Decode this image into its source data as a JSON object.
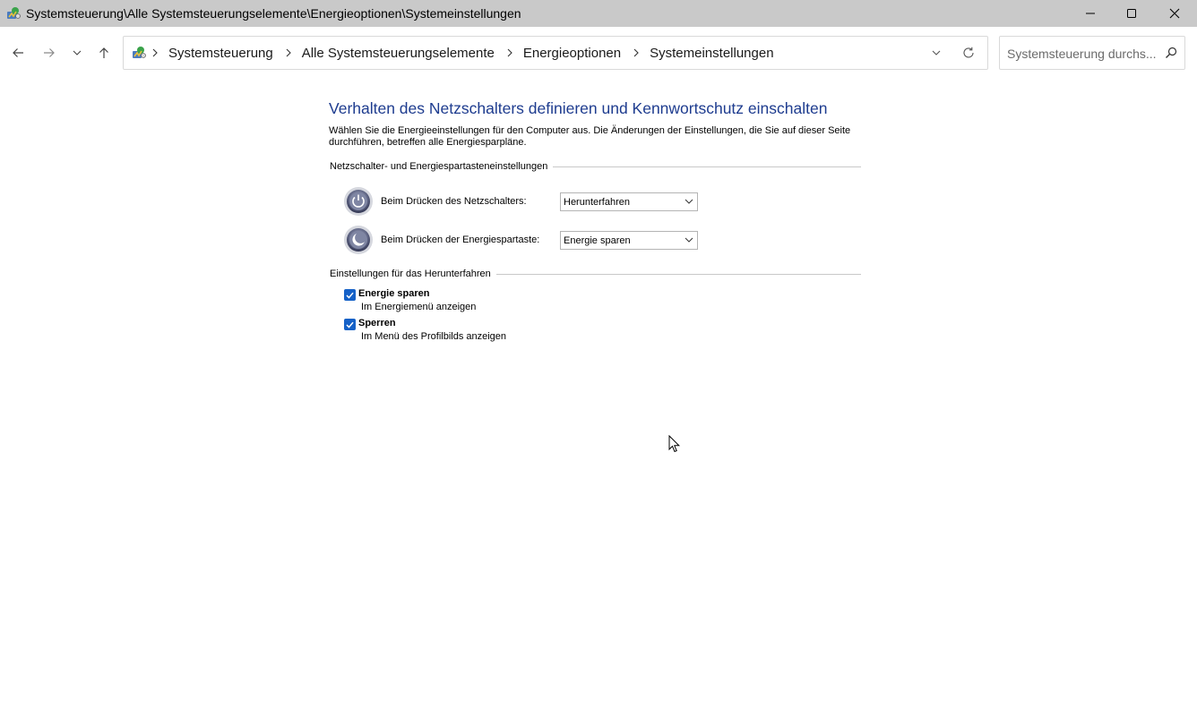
{
  "window": {
    "title": "Systemsteuerung\\Alle Systemsteuerungselemente\\Energieoptionen\\Systemeinstellungen"
  },
  "nav": {
    "breadcrumbs": [
      "Systemsteuerung",
      "Alle Systemsteuerungselemente",
      "Energieoptionen",
      "Systemeinstellungen"
    ]
  },
  "search": {
    "placeholder": "Systemsteuerung durchs..."
  },
  "main": {
    "title": "Verhalten des Netzschalters definieren und Kennwortschutz einschalten",
    "description": "Wählen Sie die Energieeinstellungen für den Computer aus. Die Änderungen der Einstellungen, die Sie auf dieser Seite durchführen, betreffen alle Energiesparpläne.",
    "power_group": {
      "header": "Netzschalter- und Energiespartasteneinstellungen",
      "rows": [
        {
          "label": "Beim Drücken des Netzschalters:",
          "value": "Herunterfahren"
        },
        {
          "label": "Beim Drücken der Energiespartaste:",
          "value": "Energie sparen"
        }
      ]
    },
    "shutdown_group": {
      "header": "Einstellungen für das Herunterfahren",
      "options": [
        {
          "label": "Energie sparen",
          "sublabel": "Im Energiemenü anzeigen",
          "checked": true
        },
        {
          "label": "Sperren",
          "sublabel": "Im Menü des Profilbilds anzeigen",
          "checked": true
        }
      ]
    }
  },
  "colors": {
    "title_blue": "#1e3c8f",
    "checkbox_blue": "#1561c7",
    "titlebar_gray": "#c9c9c9"
  }
}
